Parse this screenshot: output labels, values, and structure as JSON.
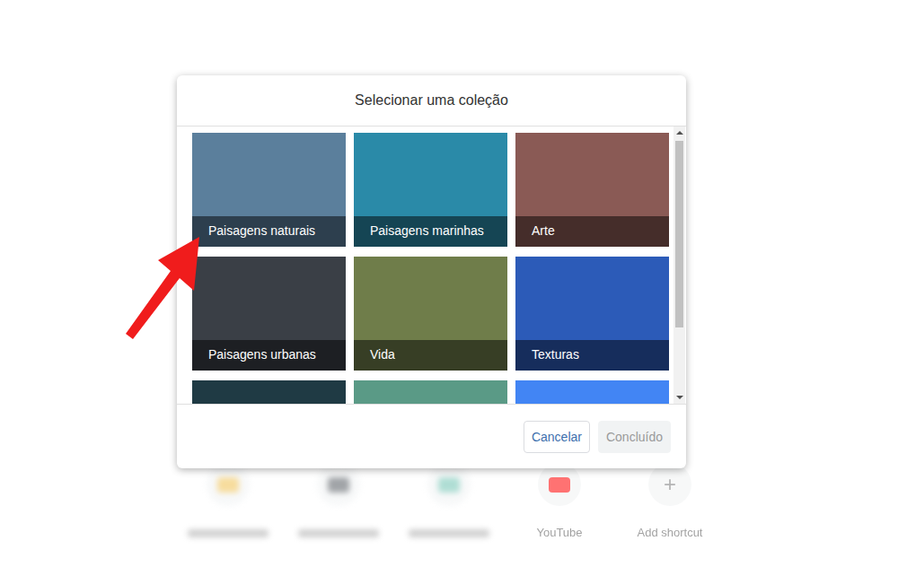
{
  "dialog": {
    "title": "Selecionar uma coleção"
  },
  "collections": [
    {
      "label": "Paisagens naturais",
      "color": "#5b7f9c"
    },
    {
      "label": "Paisagens marinhas",
      "color": "#2a8aa8"
    },
    {
      "label": "Arte",
      "color": "#8a5a55"
    },
    {
      "label": "Paisagens urbanas",
      "color": "#3a3f46"
    },
    {
      "label": "Vida",
      "color": "#6f7d4a"
    },
    {
      "label": "Texturas",
      "color": "#2c5bb8"
    },
    {
      "color": "#1f3a44"
    },
    {
      "color": "#5a9a86"
    },
    {
      "color": "#4285f4"
    }
  ],
  "buttons": [
    {
      "label": "Cancelar",
      "disabled": false
    },
    {
      "label": "Concluído",
      "disabled": true
    }
  ],
  "shortcuts": [
    {
      "blurred": true,
      "color": "#f2c14e"
    },
    {
      "blurred": true,
      "color": "#555b61"
    },
    {
      "blurred": true,
      "color": "#6fc3b2"
    },
    {
      "blurred": false,
      "label": "YouTube",
      "color": "#ff0000"
    },
    {
      "blurred": false,
      "label": "Add shortcut",
      "glyph": "+",
      "color": "#f1f3f4"
    }
  ]
}
